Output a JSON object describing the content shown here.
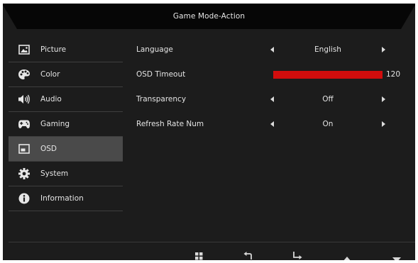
{
  "header": {
    "title": "Game Mode-Action"
  },
  "sidebar": {
    "items": [
      {
        "label": "Picture",
        "icon": "picture-icon"
      },
      {
        "label": "Color",
        "icon": "palette-icon"
      },
      {
        "label": "Audio",
        "icon": "speaker-icon"
      },
      {
        "label": "Gaming",
        "icon": "gamepad-icon"
      },
      {
        "label": "OSD",
        "icon": "osd-icon",
        "active": true
      },
      {
        "label": "System",
        "icon": "gear-icon"
      },
      {
        "label": "Information",
        "icon": "info-icon"
      }
    ]
  },
  "settings": {
    "language": {
      "label": "Language",
      "value": "English"
    },
    "osd_timeout": {
      "label": "OSD Timeout",
      "value": "120",
      "level": 1.0
    },
    "transparency": {
      "label": "Transparency",
      "value": "Off"
    },
    "refresh_rate_num": {
      "label": "Refresh Rate Num",
      "value": "On"
    }
  },
  "footer": {
    "icons": [
      "menu-grid-icon",
      "return-icon",
      "enter-icon",
      "up-arrow-icon",
      "down-arrow-icon"
    ]
  },
  "colors": {
    "background": "#1c1c1c",
    "header": "#060606",
    "active_item": "#4a4a4a",
    "slider_fill": "#d10d0d",
    "text": "#e4e4e4"
  }
}
